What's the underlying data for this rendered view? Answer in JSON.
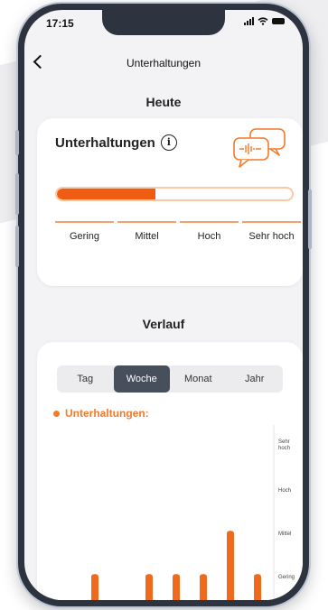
{
  "status_bar": {
    "time": "17:15"
  },
  "nav": {
    "title": "Unterhaltungen"
  },
  "today": {
    "heading": "Heute",
    "card_title": "Unterhaltungen",
    "info_icon": "info-icon",
    "illustration_icon": "chat-bubbles-icon",
    "level_fraction": 0.42,
    "levels": [
      "Gering",
      "Mittel",
      "Hoch",
      "Sehr hoch"
    ]
  },
  "history": {
    "heading": "Verlauf",
    "tabs": [
      {
        "label": "Tag",
        "active": false
      },
      {
        "label": "Woche",
        "active": true
      },
      {
        "label": "Monat",
        "active": false
      },
      {
        "label": "Jahr",
        "active": false
      }
    ],
    "legend": "Unterhaltungen:"
  },
  "colors": {
    "accent": "#f05d12",
    "bar": "#f06a1e",
    "active_tab": "#474f5c"
  },
  "chart_data": {
    "type": "bar",
    "categories": [
      "",
      "",
      "",
      "",
      "",
      "",
      ""
    ],
    "y_tick_labels": [
      "Sehr hoch",
      "Hoch",
      "Mittel",
      "Gering"
    ],
    "y_ticks": [
      4,
      3,
      2,
      1
    ],
    "values": [
      1.1,
      0.4,
      1.1,
      1.1,
      1.1,
      2.1,
      1.1
    ],
    "ylim": [
      0,
      4.2
    ],
    "legend": [
      "Unterhaltungen:"
    ],
    "grid": false
  }
}
